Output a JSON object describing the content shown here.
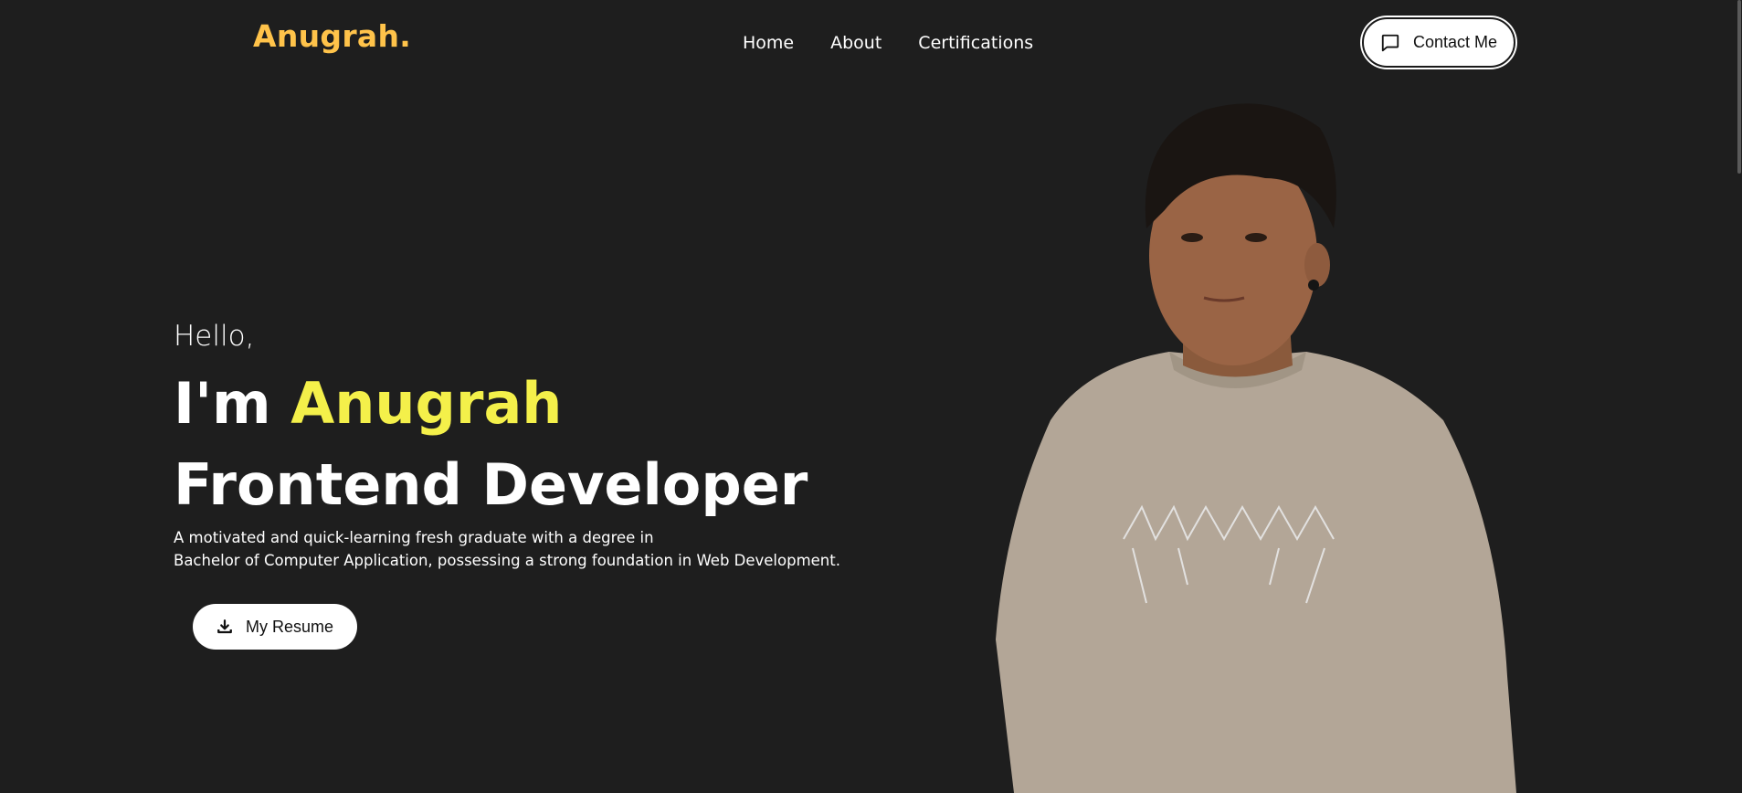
{
  "nav": {
    "logo": "Anugrah.",
    "links": [
      "Home",
      "About",
      "Certifications"
    ],
    "contact_label": "Contact Me"
  },
  "hero": {
    "greeting": "Hello,",
    "intro_prefix": "I'm",
    "intro_name": "Anugrah",
    "role": "Frontend Developer",
    "description_line1": "A motivated and quick-learning fresh graduate with a degree in",
    "description_line2": "Bachelor of Computer Application, possessing a strong foundation in Web Development.",
    "resume_label": "My Resume"
  },
  "colors": {
    "background": "#1e1e1e",
    "logo": "#ffc34a",
    "name_accent": "#f4f04a",
    "button_bg": "#ffffff"
  },
  "icons": {
    "contact": "chat-bubble-icon",
    "resume": "download-icon"
  }
}
